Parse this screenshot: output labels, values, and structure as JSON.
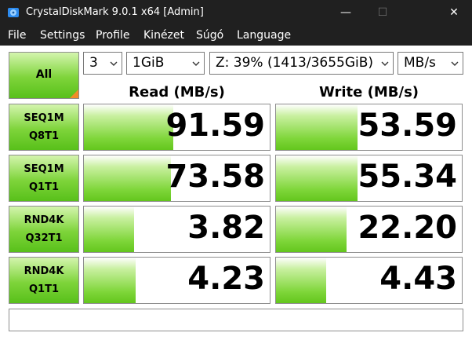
{
  "window": {
    "title": "CrystalDiskMark 9.0.1 x64 [Admin]",
    "controls": {
      "minimize": "—",
      "maximize": "☐",
      "close": "✕"
    },
    "app_icon": "crystaldiskmark-disk-icon"
  },
  "menu": [
    "File",
    "Settings",
    "Profile",
    "Kinézet",
    "Súgó",
    "Language"
  ],
  "toolbar": {
    "all_label": "All",
    "count": "3",
    "size": "1GiB",
    "drive": "Z: 39% (1413/3655GiB)",
    "unit": "MB/s"
  },
  "columns": {
    "read": "Read (MB/s)",
    "write": "Write (MB/s)"
  },
  "tests": [
    {
      "line1": "SEQ1M",
      "line2": "Q8T1",
      "read": "91.59",
      "write": "53.59",
      "read_fill": 0.48,
      "write_fill": 0.44
    },
    {
      "line1": "SEQ1M",
      "line2": "Q1T1",
      "read": "73.58",
      "write": "55.34",
      "read_fill": 0.47,
      "write_fill": 0.44
    },
    {
      "line1": "RND4K",
      "line2": "Q32T1",
      "read": "3.82",
      "write": "22.20",
      "read_fill": 0.27,
      "write_fill": 0.38
    },
    {
      "line1": "RND4K",
      "line2": "Q1T1",
      "read": "4.23",
      "write": "4.43",
      "read_fill": 0.28,
      "write_fill": 0.27
    }
  ],
  "status_text": "",
  "colors": {
    "accent_green": "#63c61d",
    "orange_corner": "#f28c28",
    "titlebar": "#202020"
  }
}
